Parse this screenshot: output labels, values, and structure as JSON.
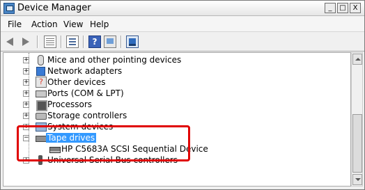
{
  "window": {
    "title": "Device Manager",
    "controls": [
      "_",
      "□",
      "X"
    ]
  },
  "menu": {
    "items": [
      "File",
      "Action",
      "View",
      "Help"
    ]
  },
  "toolbar": {
    "buttons": [
      "back-icon",
      "forward-icon",
      "show-hide-console-tree-icon",
      "properties-icon",
      "help-icon",
      "update-driver-icon",
      "list-view-icon",
      "scan-hardware-icon"
    ],
    "help_label": "?"
  },
  "tree": {
    "rows": [
      {
        "label": "Mice and other pointing devices",
        "expander": "+",
        "icon": "mouse-icon"
      },
      {
        "label": "Network adapters",
        "expander": "+",
        "icon": "network-adapter-icon"
      },
      {
        "label": "Other devices",
        "expander": "+",
        "icon": "other-devices-icon"
      },
      {
        "label": "Ports (COM & LPT)",
        "expander": "+",
        "icon": "port-icon"
      },
      {
        "label": "Processors",
        "expander": "+",
        "icon": "processor-icon"
      },
      {
        "label": "Storage controllers",
        "expander": "+",
        "icon": "storage-controller-icon"
      },
      {
        "label": "System devices",
        "expander": "+",
        "icon": "system-devices-icon"
      },
      {
        "label": "Tape drives",
        "expander": "−",
        "icon": "tape-drive-icon",
        "selected": true
      },
      {
        "label": "HP C5683A SCSI Sequential Device",
        "expander": "",
        "icon": "tape-device-icon"
      },
      {
        "label": "Universal Serial Bus controllers",
        "expander": "+",
        "icon": "usb-controller-icon"
      }
    ]
  },
  "annotation": {
    "color": "#e00000"
  },
  "colors": {
    "selection": "#3399ff",
    "highlight": "#e00000"
  }
}
